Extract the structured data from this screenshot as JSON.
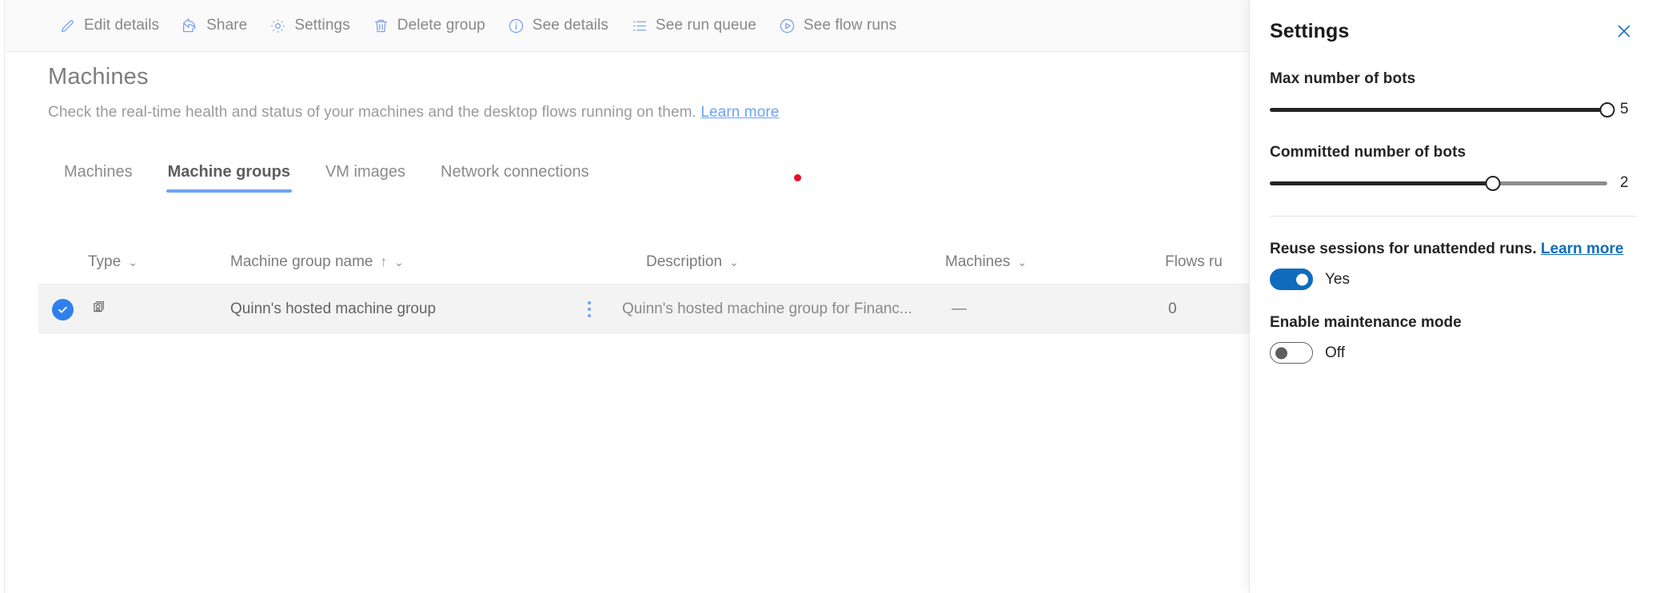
{
  "commandbar": {
    "items": [
      {
        "label": "Edit details",
        "icon": "pencil-icon"
      },
      {
        "label": "Share",
        "icon": "share-icon"
      },
      {
        "label": "Settings",
        "icon": "gear-icon"
      },
      {
        "label": "Delete group",
        "icon": "trash-icon"
      },
      {
        "label": "See details",
        "icon": "info-icon"
      },
      {
        "label": "See run queue",
        "icon": "list-icon"
      },
      {
        "label": "See flow runs",
        "icon": "play-circle-icon"
      }
    ]
  },
  "page": {
    "title": "Machines",
    "subtitle": "Check the real-time health and status of your machines and the desktop flows running on them.",
    "learn_more": "Learn more"
  },
  "tabs": [
    {
      "label": "Machines",
      "active": false
    },
    {
      "label": "Machine groups",
      "active": true
    },
    {
      "label": "VM images",
      "active": false
    },
    {
      "label": "Network connections",
      "active": false
    }
  ],
  "table": {
    "headers": {
      "type": "Type",
      "name": "Machine group name",
      "description": "Description",
      "machines": "Machines",
      "flows": "Flows ru"
    },
    "sort_indicator": "↑",
    "chevron": "⌄",
    "rows": [
      {
        "selected": true,
        "type_icon": "machine-group-icon",
        "name": "Quinn's hosted machine group",
        "description": "Quinn's hosted machine group for Financ...",
        "machines": "—",
        "flows": "0"
      }
    ]
  },
  "panel": {
    "title": "Settings",
    "close_icon": "close-icon",
    "max_bots": {
      "label": "Max number of bots",
      "value": "5",
      "percent": 100
    },
    "committed_bots": {
      "label": "Committed number of bots",
      "value": "2",
      "percent": 66
    },
    "reuse_sessions": {
      "label": "Reuse sessions for unattended runs.",
      "link": "Learn more",
      "state": "Yes",
      "on": true
    },
    "maintenance_mode": {
      "label": "Enable maintenance mode",
      "state": "Off",
      "on": false
    }
  },
  "colors": {
    "accent": "#0f6cbd",
    "command_icon": "#7aa3f0",
    "tab_underline": "#6da3f5",
    "alert_dot": "#e81123",
    "row_selected_bg": "#f3f3f3"
  }
}
